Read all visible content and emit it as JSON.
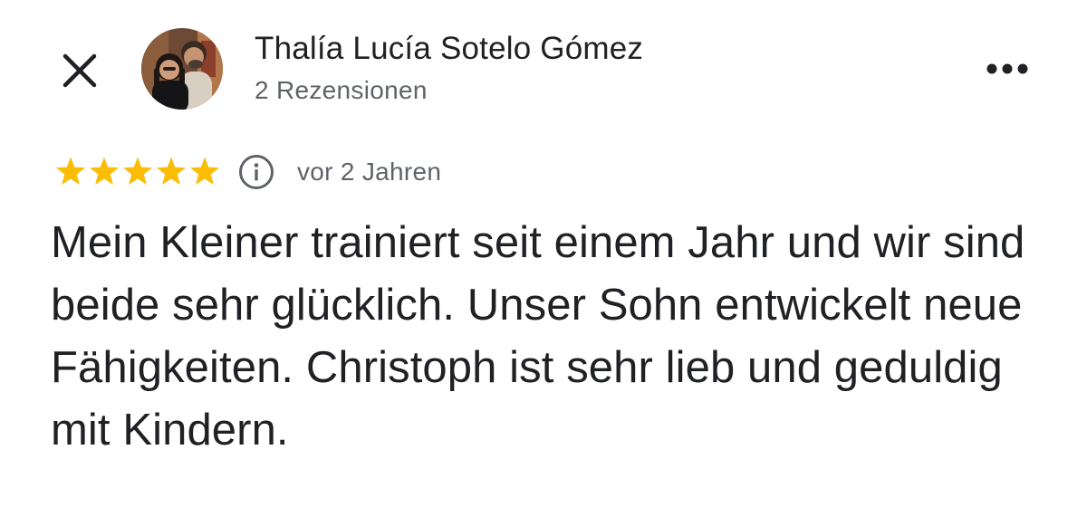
{
  "header": {
    "close_icon": "close-icon",
    "reviewer_name": "Thalía Lucía Sotelo Gómez",
    "review_count": "2 Rezensionen",
    "more_icon": "more-horizontal-icon"
  },
  "review": {
    "rating": 5,
    "max_rating": 5,
    "star_color": "#fbbc04",
    "info_icon": "info-icon",
    "date": "vor 2 Jahren",
    "text": "Mein Kleiner trainiert seit einem Jahr und wir sind beide sehr glücklich. Unser Sohn entwickelt neue Fähigkeiten. Christoph ist sehr lieb und geduldig mit Kindern."
  },
  "colors": {
    "primary_text": "#202124",
    "secondary_text": "#5f6368",
    "background": "#ffffff"
  }
}
